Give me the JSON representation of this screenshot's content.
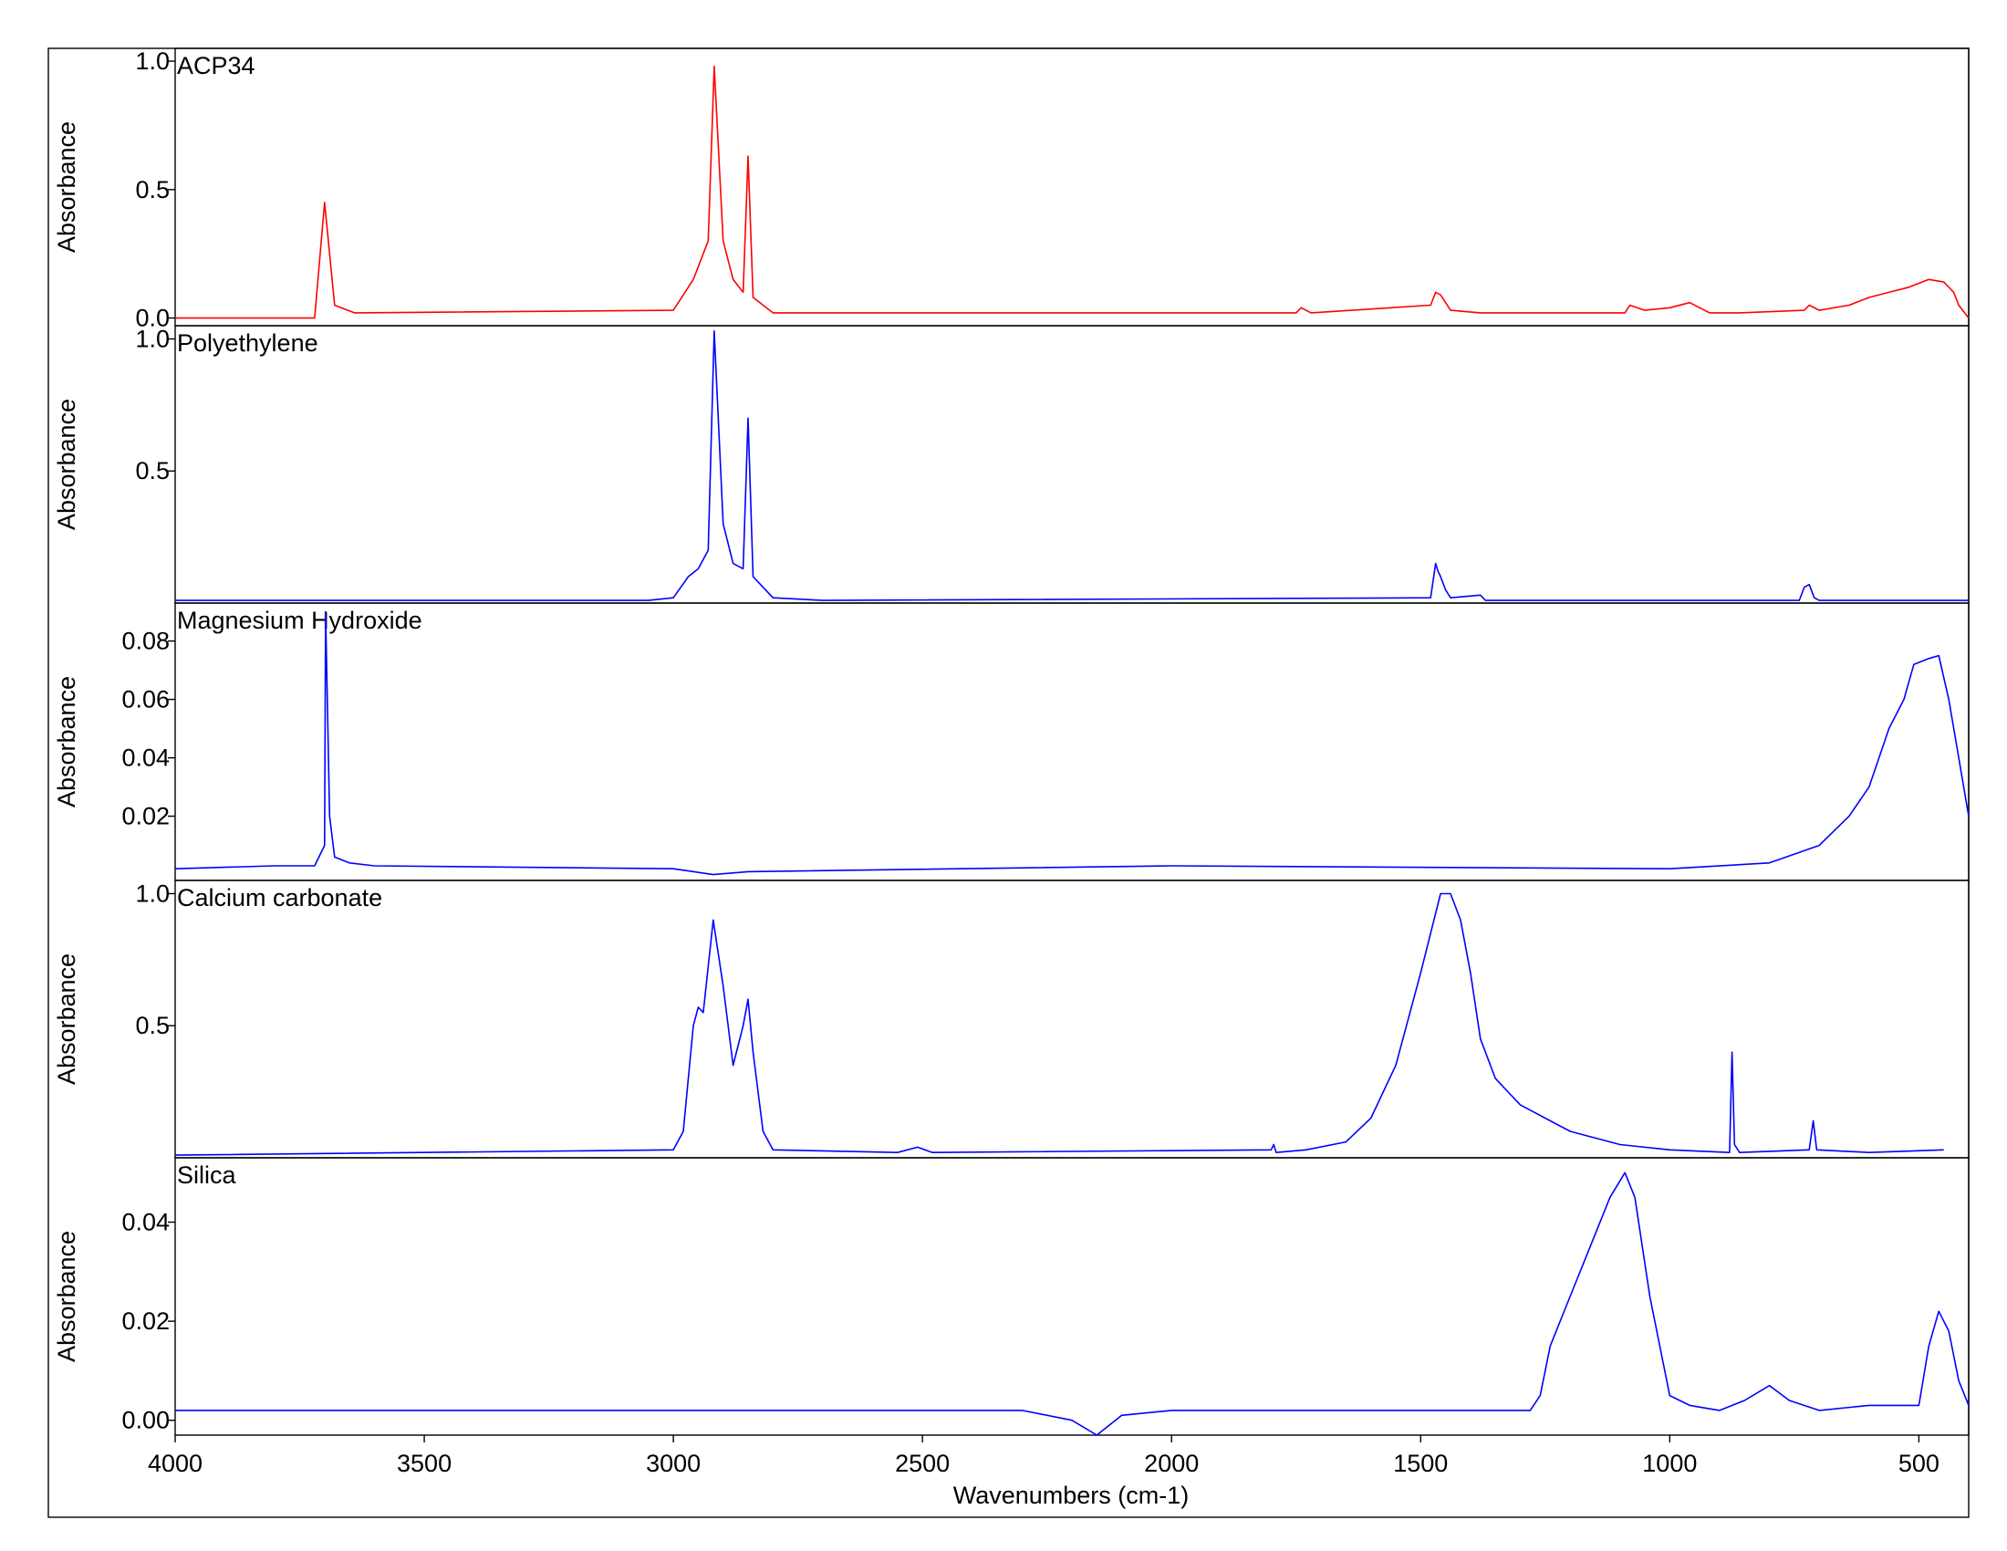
{
  "colors": {
    "red": "#ff0000",
    "blue": "#0000ff",
    "axis": "#000000"
  },
  "chart_data": {
    "type": "line",
    "xlabel": "Wavenumbers (cm-1)",
    "xlim": [
      4000,
      400
    ],
    "xticks": [
      4000,
      3500,
      3000,
      2500,
      2000,
      1500,
      1000,
      500
    ],
    "xtick_labels": [
      "4000",
      "3500",
      "3000",
      "2500",
      "2000",
      "1500",
      "1000",
      "500"
    ],
    "panels": [
      {
        "name": "ACP34",
        "ylabel": "Absorbance",
        "ylim": [
          -0.03,
          1.05
        ],
        "yticks": [
          0.0,
          0.5,
          1.0
        ],
        "ytick_labels": [
          "0.0",
          "0.5",
          "1.0"
        ],
        "color": "red",
        "points": [
          [
            4000,
            0.0
          ],
          [
            3720,
            0.0
          ],
          [
            3700,
            0.45
          ],
          [
            3680,
            0.05
          ],
          [
            3640,
            0.02
          ],
          [
            3000,
            0.03
          ],
          [
            2960,
            0.15
          ],
          [
            2930,
            0.3
          ],
          [
            2918,
            0.98
          ],
          [
            2900,
            0.3
          ],
          [
            2880,
            0.15
          ],
          [
            2860,
            0.1
          ],
          [
            2850,
            0.63
          ],
          [
            2840,
            0.08
          ],
          [
            2800,
            0.02
          ],
          [
            1900,
            0.02
          ],
          [
            1750,
            0.02
          ],
          [
            1740,
            0.04
          ],
          [
            1720,
            0.02
          ],
          [
            1480,
            0.05
          ],
          [
            1470,
            0.1
          ],
          [
            1460,
            0.09
          ],
          [
            1440,
            0.03
          ],
          [
            1380,
            0.02
          ],
          [
            1090,
            0.02
          ],
          [
            1080,
            0.05
          ],
          [
            1050,
            0.03
          ],
          [
            1000,
            0.04
          ],
          [
            960,
            0.06
          ],
          [
            920,
            0.02
          ],
          [
            880,
            0.02
          ],
          [
            860,
            0.02
          ],
          [
            730,
            0.03
          ],
          [
            720,
            0.05
          ],
          [
            700,
            0.03
          ],
          [
            640,
            0.05
          ],
          [
            600,
            0.08
          ],
          [
            560,
            0.1
          ],
          [
            520,
            0.12
          ],
          [
            480,
            0.15
          ],
          [
            450,
            0.14
          ],
          [
            430,
            0.1
          ],
          [
            420,
            0.05
          ],
          [
            400,
            0.0
          ]
        ]
      },
      {
        "name": "Polyethylene",
        "ylabel": "Absorbance",
        "ylim": [
          0.0,
          1.05
        ],
        "yticks": [
          0.5,
          1.0
        ],
        "ytick_labels": [
          "0.5",
          "1.0"
        ],
        "color": "blue",
        "points": [
          [
            4000,
            0.01
          ],
          [
            3050,
            0.01
          ],
          [
            3000,
            0.02
          ],
          [
            2970,
            0.1
          ],
          [
            2950,
            0.13
          ],
          [
            2930,
            0.2
          ],
          [
            2918,
            1.03
          ],
          [
            2900,
            0.3
          ],
          [
            2880,
            0.15
          ],
          [
            2860,
            0.13
          ],
          [
            2850,
            0.7
          ],
          [
            2840,
            0.1
          ],
          [
            2800,
            0.02
          ],
          [
            2700,
            0.01
          ],
          [
            1480,
            0.02
          ],
          [
            1470,
            0.15
          ],
          [
            1465,
            0.12
          ],
          [
            1460,
            0.1
          ],
          [
            1450,
            0.05
          ],
          [
            1440,
            0.02
          ],
          [
            1380,
            0.03
          ],
          [
            1370,
            0.01
          ],
          [
            740,
            0.01
          ],
          [
            730,
            0.06
          ],
          [
            720,
            0.07
          ],
          [
            710,
            0.02
          ],
          [
            700,
            0.01
          ],
          [
            400,
            0.01
          ]
        ]
      },
      {
        "name": "Magnesium Hydroxide",
        "ylabel": "Absorbance",
        "ylim": [
          -0.002,
          0.093
        ],
        "yticks": [
          0.02,
          0.04,
          0.06,
          0.08
        ],
        "ytick_labels": [
          "0.02",
          "0.04",
          "0.06",
          "0.08"
        ],
        "color": "blue",
        "points": [
          [
            4000,
            0.002
          ],
          [
            3800,
            0.003
          ],
          [
            3720,
            0.003
          ],
          [
            3700,
            0.01
          ],
          [
            3698,
            0.09
          ],
          [
            3690,
            0.02
          ],
          [
            3680,
            0.006
          ],
          [
            3650,
            0.004
          ],
          [
            3600,
            0.003
          ],
          [
            3000,
            0.002
          ],
          [
            2920,
            0.0
          ],
          [
            2850,
            0.001
          ],
          [
            2000,
            0.003
          ],
          [
            1000,
            0.002
          ],
          [
            800,
            0.004
          ],
          [
            700,
            0.01
          ],
          [
            640,
            0.02
          ],
          [
            600,
            0.03
          ],
          [
            560,
            0.05
          ],
          [
            530,
            0.06
          ],
          [
            510,
            0.072
          ],
          [
            480,
            0.074
          ],
          [
            460,
            0.075
          ],
          [
            440,
            0.06
          ],
          [
            420,
            0.04
          ],
          [
            400,
            0.02
          ]
        ]
      },
      {
        "name": "Calcium carbonate",
        "ylabel": "Absorbance",
        "ylim": [
          0.0,
          1.05
        ],
        "yticks": [
          0.5,
          1.0
        ],
        "ytick_labels": [
          "0.5",
          "1.0"
        ],
        "color": "blue",
        "points": [
          [
            4000,
            0.01
          ],
          [
            3000,
            0.03
          ],
          [
            2980,
            0.1
          ],
          [
            2960,
            0.5
          ],
          [
            2950,
            0.57
          ],
          [
            2940,
            0.55
          ],
          [
            2920,
            0.9
          ],
          [
            2900,
            0.65
          ],
          [
            2880,
            0.35
          ],
          [
            2860,
            0.5
          ],
          [
            2850,
            0.6
          ],
          [
            2840,
            0.4
          ],
          [
            2820,
            0.1
          ],
          [
            2800,
            0.03
          ],
          [
            2550,
            0.02
          ],
          [
            2510,
            0.04
          ],
          [
            2480,
            0.02
          ],
          [
            1800,
            0.03
          ],
          [
            1795,
            0.05
          ],
          [
            1790,
            0.02
          ],
          [
            1730,
            0.03
          ],
          [
            1650,
            0.06
          ],
          [
            1600,
            0.15
          ],
          [
            1550,
            0.35
          ],
          [
            1500,
            0.7
          ],
          [
            1460,
            1.0
          ],
          [
            1440,
            1.0
          ],
          [
            1420,
            0.9
          ],
          [
            1400,
            0.7
          ],
          [
            1380,
            0.45
          ],
          [
            1350,
            0.3
          ],
          [
            1300,
            0.2
          ],
          [
            1200,
            0.1
          ],
          [
            1100,
            0.05
          ],
          [
            1000,
            0.03
          ],
          [
            880,
            0.02
          ],
          [
            875,
            0.4
          ],
          [
            870,
            0.05
          ],
          [
            860,
            0.02
          ],
          [
            720,
            0.03
          ],
          [
            712,
            0.14
          ],
          [
            705,
            0.03
          ],
          [
            600,
            0.02
          ],
          [
            450,
            0.03
          ]
        ]
      },
      {
        "name": "Silica",
        "ylabel": "Absorbance",
        "ylim": [
          -0.003,
          0.053
        ],
        "yticks": [
          0.0,
          0.02,
          0.04
        ],
        "ytick_labels": [
          "0.00",
          "0.02",
          "0.04"
        ],
        "color": "blue",
        "points": [
          [
            4000,
            0.002
          ],
          [
            2300,
            0.002
          ],
          [
            2200,
            0.0
          ],
          [
            2150,
            -0.003
          ],
          [
            2100,
            0.001
          ],
          [
            2000,
            0.002
          ],
          [
            1900,
            0.002
          ],
          [
            1280,
            0.002
          ],
          [
            1260,
            0.005
          ],
          [
            1240,
            0.015
          ],
          [
            1200,
            0.025
          ],
          [
            1160,
            0.035
          ],
          [
            1120,
            0.045
          ],
          [
            1090,
            0.05
          ],
          [
            1070,
            0.045
          ],
          [
            1040,
            0.025
          ],
          [
            1000,
            0.005
          ],
          [
            960,
            0.003
          ],
          [
            900,
            0.002
          ],
          [
            850,
            0.004
          ],
          [
            800,
            0.007
          ],
          [
            760,
            0.004
          ],
          [
            700,
            0.002
          ],
          [
            600,
            0.003
          ],
          [
            500,
            0.003
          ],
          [
            480,
            0.015
          ],
          [
            460,
            0.022
          ],
          [
            440,
            0.018
          ],
          [
            420,
            0.008
          ],
          [
            400,
            0.003
          ]
        ]
      }
    ]
  }
}
